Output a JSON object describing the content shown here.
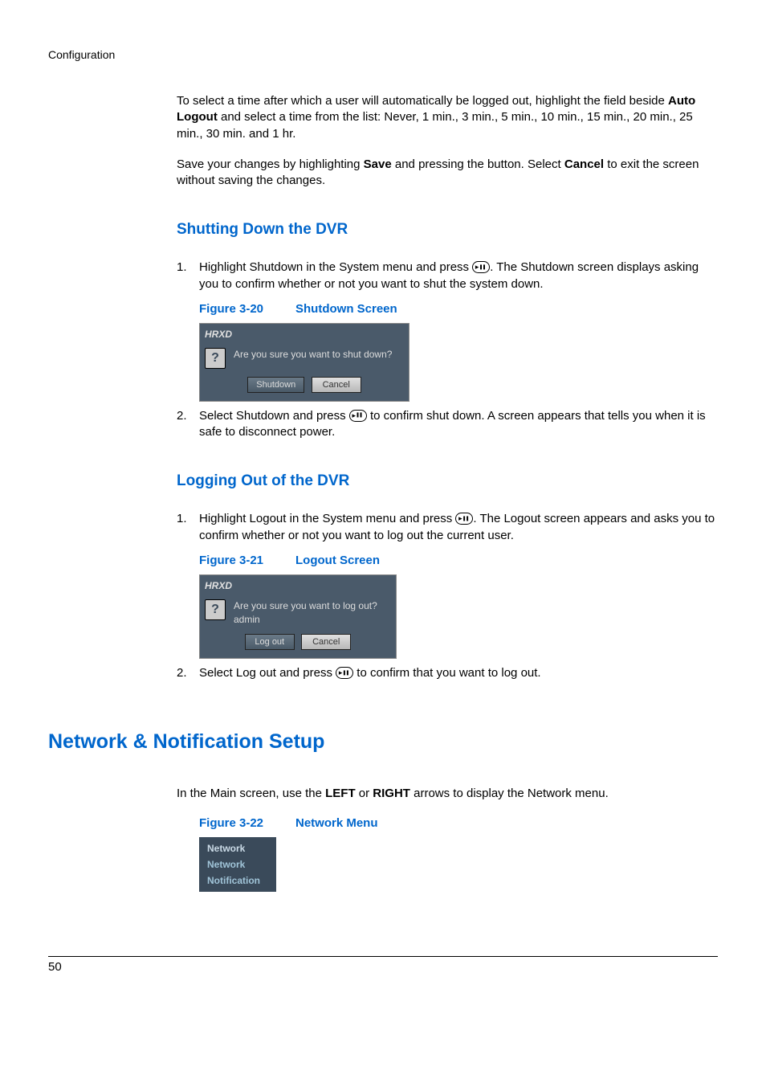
{
  "breadcrumb": "Configuration",
  "intro": {
    "p1_prefix": "To select a time after which a user will automatically be logged out, highlight the field beside ",
    "p1_bold1": "Auto Logout",
    "p1_suffix": " and select a time from the list: Never, 1 min., 3 min., 5 min., 10 min., 15 min., 20 min., 25 min., 30 min. and 1 hr.",
    "p2_prefix": "Save your changes by highlighting ",
    "p2_bold1": "Save",
    "p2_mid": " and pressing the button. Select ",
    "p2_bold2": "Cancel",
    "p2_suffix": " to exit the screen without saving the changes."
  },
  "shutdown": {
    "heading": "Shutting Down the DVR",
    "step1_num": "1.",
    "step1_prefix": "Highlight ",
    "step1_bold": "Shutdown",
    "step1_mid": " in the System menu and press ",
    "step1_suffix": ". The Shutdown screen displays asking you to confirm whether or not you want to shut the system down.",
    "fig_num": "Figure 3-20",
    "fig_title": "Shutdown Screen",
    "dialog_title": "HRXD",
    "dialog_text": "Are you sure you want to shut down?",
    "btn1": "Shutdown",
    "btn2": "Cancel",
    "step2_num": "2.",
    "step2_prefix": "Select ",
    "step2_bold": "Shutdown",
    "step2_mid": " and press ",
    "step2_suffix": " to confirm shut down. A screen appears that tells you when it is safe to disconnect power."
  },
  "logout": {
    "heading": "Logging Out of the DVR",
    "step1_num": "1.",
    "step1_prefix": "Highlight ",
    "step1_bold": "Logout",
    "step1_mid": " in the System menu and press ",
    "step1_suffix": ". The Logout screen appears and asks you to confirm whether or not you want to log out the current user.",
    "fig_num": "Figure 3-21",
    "fig_title": "Logout Screen",
    "dialog_title": "HRXD",
    "dialog_text": "Are you sure you want to log out?",
    "dialog_user": "admin",
    "btn1": "Log out",
    "btn2": "Cancel",
    "step2_num": "2.",
    "step2_prefix": "Select ",
    "step2_bold": "Log out",
    "step2_mid": " and press ",
    "step2_suffix": " to confirm that you want to log out."
  },
  "network": {
    "heading": "Network & Notification Setup",
    "intro_prefix": "In the Main screen, use the ",
    "intro_bold1": "LEFT",
    "intro_mid": " or ",
    "intro_bold2": "RIGHT",
    "intro_suffix": " arrows to display the Network menu.",
    "fig_num": "Figure 3-22",
    "fig_title": "Network Menu",
    "menu_items": [
      "Network",
      "Network",
      "Notification"
    ]
  },
  "footer_page": "50"
}
